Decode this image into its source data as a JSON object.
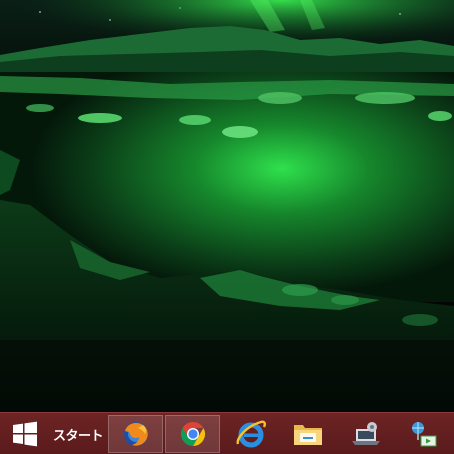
{
  "desktop": {
    "wallpaper": "aurora-glacier-lagoon",
    "colors": {
      "aurora": "#3dff55",
      "water": "#0f5a20",
      "sky": "#041a0e"
    }
  },
  "taskbar": {
    "background": "#5f1d1f",
    "start": {
      "label": "スタート",
      "icon": "windows-logo-icon"
    },
    "items": [
      {
        "name": "firefox",
        "icon": "firefox-icon",
        "running": true
      },
      {
        "name": "chrome",
        "icon": "chrome-icon",
        "running": true
      },
      {
        "name": "internet-explorer",
        "icon": "internet-explorer-icon",
        "running": false
      },
      {
        "name": "file-explorer",
        "icon": "folder-icon",
        "running": false
      },
      {
        "name": "control-panel",
        "icon": "laptop-settings-icon",
        "running": false
      },
      {
        "name": "network",
        "icon": "network-globe-icon",
        "running": false
      }
    ]
  }
}
